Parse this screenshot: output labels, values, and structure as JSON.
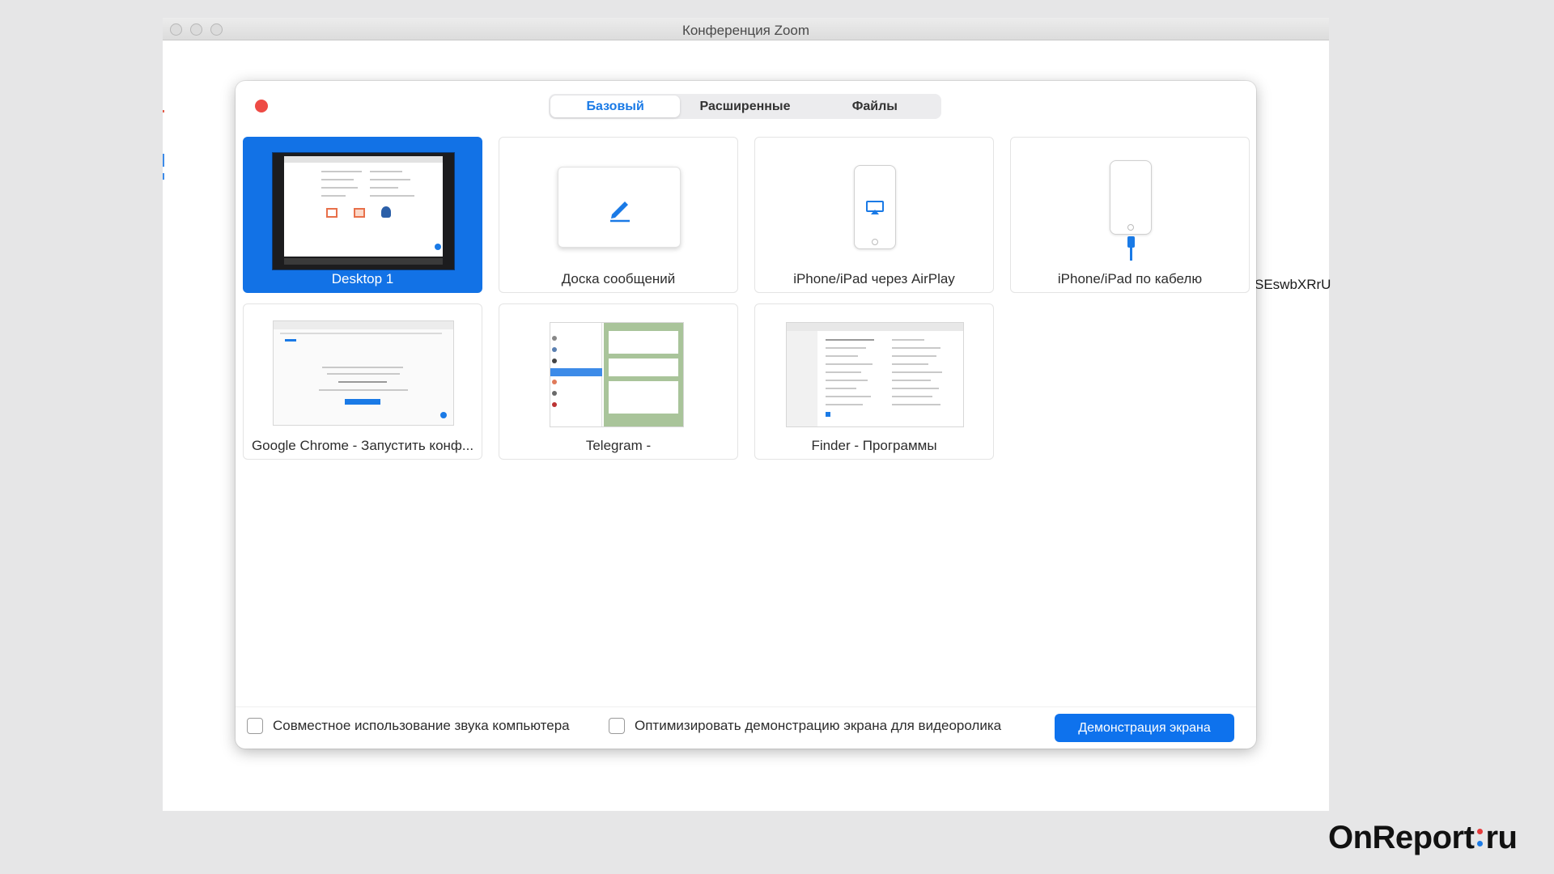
{
  "window": {
    "title": "Конференция Zoom"
  },
  "background_text": "SEswbXRrU",
  "tabs": [
    {
      "label": "Базовый",
      "active": true
    },
    {
      "label": "Расширенные",
      "active": false
    },
    {
      "label": "Файлы",
      "active": false
    }
  ],
  "sources": [
    {
      "label": "Desktop 1",
      "selected": true,
      "kind": "desktop"
    },
    {
      "label": "Доска сообщений",
      "selected": false,
      "kind": "whiteboard"
    },
    {
      "label": "iPhone/iPad через AirPlay",
      "selected": false,
      "kind": "airplay"
    },
    {
      "label": "iPhone/iPad по кабелю",
      "selected": false,
      "kind": "cable"
    },
    {
      "label": "Google Chrome - Запустить конф...",
      "selected": false,
      "kind": "window"
    },
    {
      "label": "Telegram -",
      "selected": false,
      "kind": "window"
    },
    {
      "label": "Finder - Программы",
      "selected": false,
      "kind": "window"
    }
  ],
  "options": {
    "share_sound": "Совместное использование звука компьютера",
    "optimize_video": "Оптимизировать демонстрацию экрана для видеоролика"
  },
  "share_button": "Демонстрация экрана",
  "watermark": {
    "left": "OnReport",
    "right": "ru"
  },
  "colors": {
    "accent": "#0e72ed",
    "selected_tile": "#1272e6",
    "close": "#ee4b45"
  }
}
